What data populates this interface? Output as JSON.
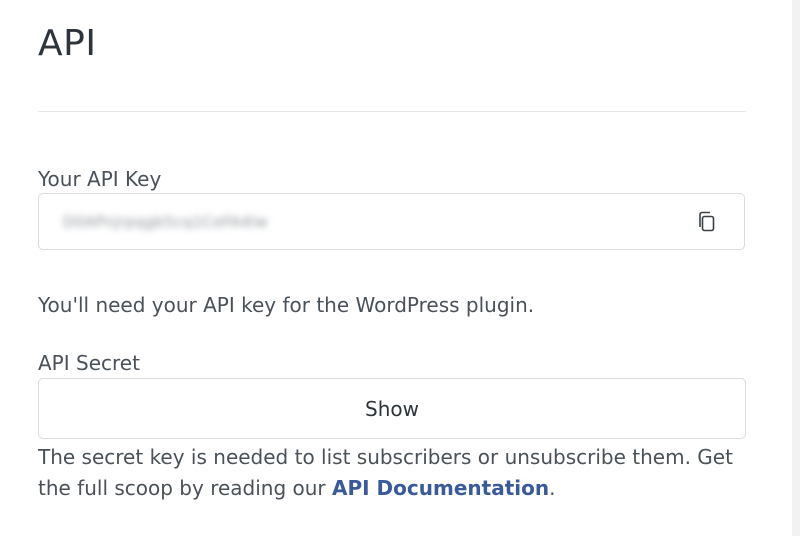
{
  "page": {
    "title": "API"
  },
  "api_key": {
    "label": "Your API Key",
    "value": "D0APnjrpqgb5cq1CeFA4lw",
    "copy_icon": "copy-icon",
    "help": "You'll need your API key for the WordPress plugin."
  },
  "api_secret": {
    "label": "API Secret",
    "show_label": "Show",
    "help_before": "The secret key is needed to list subscribers or unsubscribe them. Get the full scoop by reading our ",
    "doc_link": "API Documentation",
    "help_after": "."
  },
  "colors": {
    "link": "#3b5a9a",
    "border": "#d9dde1",
    "text": "#4a5159"
  }
}
